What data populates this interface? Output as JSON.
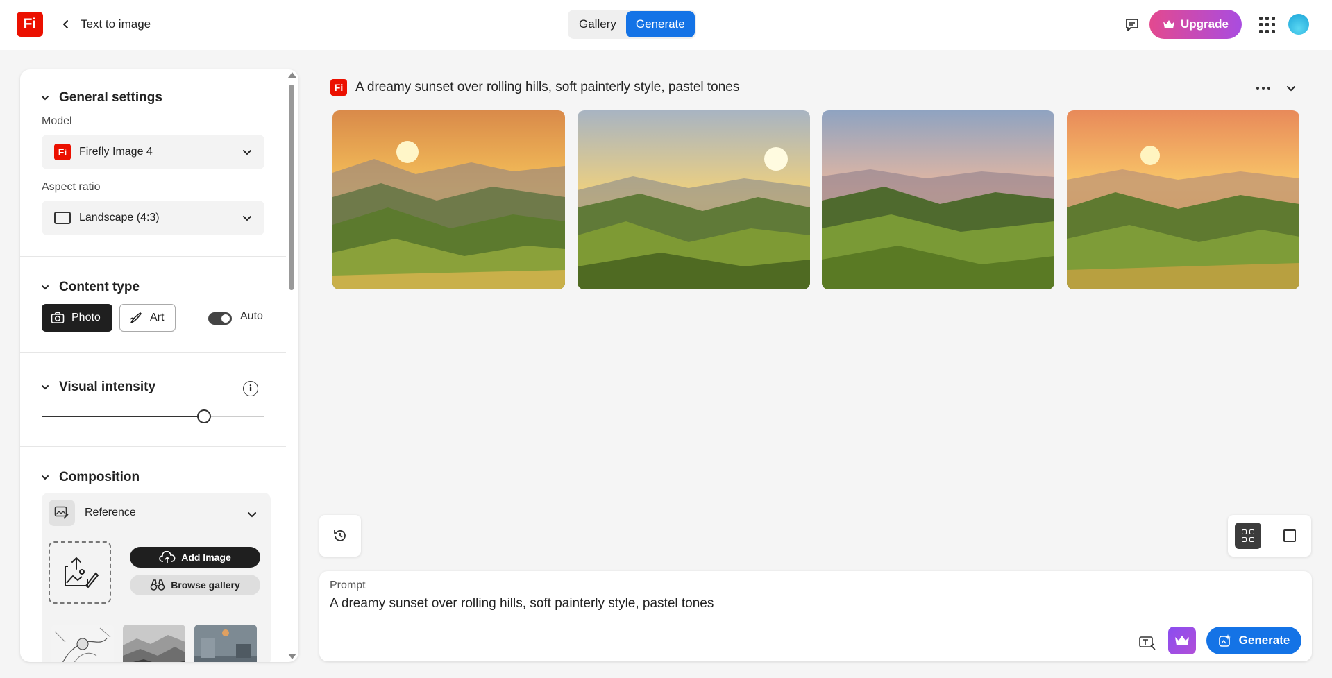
{
  "header": {
    "logo_text": "Fi",
    "page_title": "Text to image",
    "tabs": [
      {
        "label": "Gallery",
        "active": false
      },
      {
        "label": "Generate",
        "active": true
      }
    ],
    "upgrade_label": "Upgrade"
  },
  "sidebar": {
    "general": {
      "title": "General settings",
      "model_label": "Model",
      "model_value": "Firefly Image 4",
      "model_icon_text": "Fi",
      "aspect_label": "Aspect ratio",
      "aspect_value": "Landscape (4:3)"
    },
    "content_type": {
      "title": "Content type",
      "photo_label": "Photo",
      "art_label": "Art",
      "auto_label": "Auto",
      "auto_on": true
    },
    "visual_intensity": {
      "title": "Visual intensity",
      "value_fraction": 0.73
    },
    "composition": {
      "title": "Composition",
      "reference_label": "Reference",
      "add_image_label": "Add Image",
      "browse_gallery_label": "Browse gallery"
    }
  },
  "results": {
    "logo_text": "Fi",
    "prompt_title": "A dreamy sunset over rolling hills, soft painterly style, pastel tones",
    "image_count": 4
  },
  "prompt": {
    "label": "Prompt",
    "value": "A dreamy sunset over rolling hills, soft painterly style, pastel tones",
    "generate_label": "Generate"
  },
  "colors": {
    "accent": "#1473e6",
    "brand": "#eb1000",
    "upgrade_gradient_start": "#e3498f",
    "upgrade_gradient_end": "#a94ce0"
  }
}
